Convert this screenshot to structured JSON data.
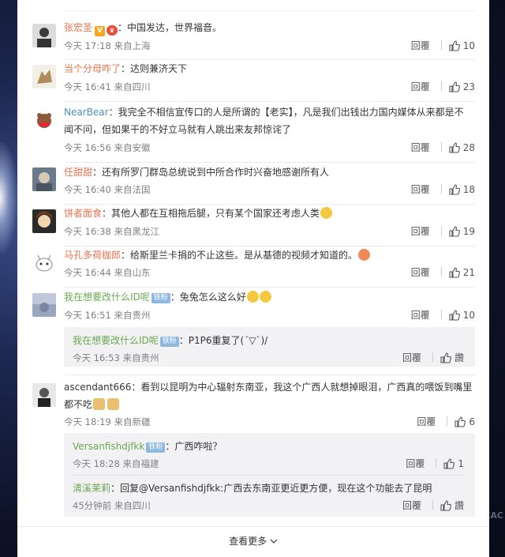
{
  "reply_label": "回覆",
  "like_glyph": "讚",
  "comments": [
    {
      "user": "张宏圣",
      "text": "：中国发达，世界福音。",
      "meta": "今天 17:18 来自上海",
      "likes": "10"
    },
    {
      "user": "当个分母咋了",
      "text": "：达则兼济天下",
      "meta": "今天 16:41 来自四川",
      "likes": "23"
    },
    {
      "user": "NearBear",
      "text_line1": "：我完全不相信宣传口的人是所谓的【老实】，凡是我们出钱出力国内媒体从来都是不",
      "text_line2": "闻不问，但如果干的不好立马就有人跳出来友邦惊诧了",
      "meta": "今天 16:56 来自安徽",
      "likes": "28"
    },
    {
      "user": "任甜甜",
      "text": "：还有所罗门群岛总统说到中所合作时兴奋地感谢所有人",
      "meta": "今天 16:40 来自法国",
      "likes": "18"
    },
    {
      "user": "饼者面食",
      "text": "：其他人都在互相拖后腿，只有某个国家还考虑人类",
      "meta": "今天 16:38 来自黑龙江",
      "likes": "19"
    },
    {
      "user": "马孔多荷枷郎",
      "text": "：给斯里兰卡捐的不止这些。是从基德的视频才知道的。",
      "meta": "今天 16:44 来自山东",
      "likes": "21"
    },
    {
      "user": "我在想要改什么ID呢",
      "fan": "铁粉",
      "text": "：兔兔怎么这么好",
      "meta": "今天 16:51 来自贵州",
      "likes": "10"
    },
    {
      "user": "ascendant666",
      "text_line1": "：看到以昆明为中心辐射东南亚，我这个广西人就想掉眼泪，广西真的喂饭到嘴里",
      "text_line2": "都不吃",
      "meta": "今天 18:19 来自新疆",
      "likes": "6"
    }
  ],
  "subreplies": [
    {
      "user": "我在想要改什么ID呢",
      "fan": "铁粉",
      "text": "：P1P6重复了(´▽`)/",
      "meta": "今天 16:53 来自贵州"
    },
    {
      "user": "Versanfishdjfkk",
      "fan": "铁粉",
      "text": "：广西咋啦？",
      "meta": "今天 18:28 来自福建",
      "likes": "1"
    },
    {
      "user": "清溪茉莉",
      "text": "：回复@Versanfishdjfkk:广西去东南亚更近更方便，现在这个功能去了昆明",
      "meta": "45分钟前 来自四川"
    }
  ],
  "load_more": "查看更多",
  "bg_text": "CAC"
}
